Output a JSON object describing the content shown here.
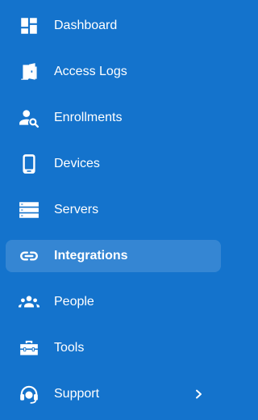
{
  "theme": {
    "background": "#1473cc",
    "active_background": "rgba(255,255,255,0.14)",
    "text": "#ffffff"
  },
  "nav": {
    "items": [
      {
        "label": "Dashboard",
        "icon": "dashboard-icon",
        "active": false
      },
      {
        "label": "Access Logs",
        "icon": "door-icon",
        "active": false
      },
      {
        "label": "Enrollments",
        "icon": "person-search-icon",
        "active": false
      },
      {
        "label": "Devices",
        "icon": "tablet-icon",
        "active": false
      },
      {
        "label": "Servers",
        "icon": "server-icon",
        "active": false
      },
      {
        "label": "Integrations",
        "icon": "link-icon",
        "active": true
      },
      {
        "label": "People",
        "icon": "group-icon",
        "active": false
      },
      {
        "label": "Tools",
        "icon": "toolbox-icon",
        "active": false
      },
      {
        "label": "Support",
        "icon": "headset-icon",
        "active": false,
        "expandable": true,
        "expand_icon": "chevron-right-icon"
      }
    ]
  }
}
